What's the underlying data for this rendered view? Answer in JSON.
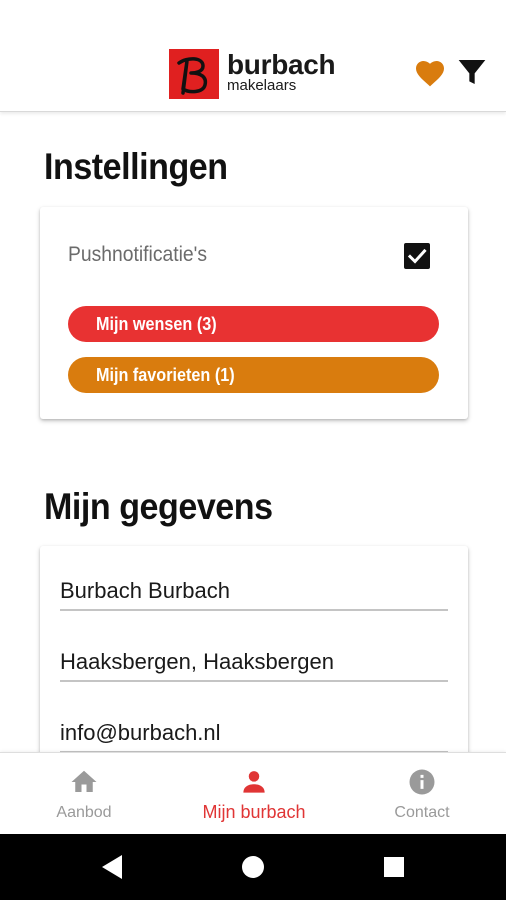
{
  "header": {
    "logo_name": "burbach",
    "logo_sub": "makelaars"
  },
  "settings": {
    "title": "Instellingen",
    "push_label": "Pushnotificatie's",
    "push_enabled": true,
    "wishes_label": "Mijn wensen (3)",
    "favorites_label": "Mijn favorieten (1)"
  },
  "profile": {
    "title": "Mijn gegevens",
    "name": "Burbach Burbach",
    "place": "Haaksbergen, Haaksbergen",
    "email": "info@burbach.nl"
  },
  "nav": {
    "items": [
      {
        "label": "Aanbod",
        "icon": "home-icon",
        "active": false
      },
      {
        "label": "Mijn burbach",
        "icon": "person-icon",
        "active": true
      },
      {
        "label": "Contact",
        "icon": "info-icon",
        "active": false
      }
    ]
  },
  "colors": {
    "brand_red": "#e02020",
    "wishes": "#e83232",
    "favorites": "#d97c0e",
    "heart": "#d97c0e",
    "active_nav": "#e03535"
  }
}
